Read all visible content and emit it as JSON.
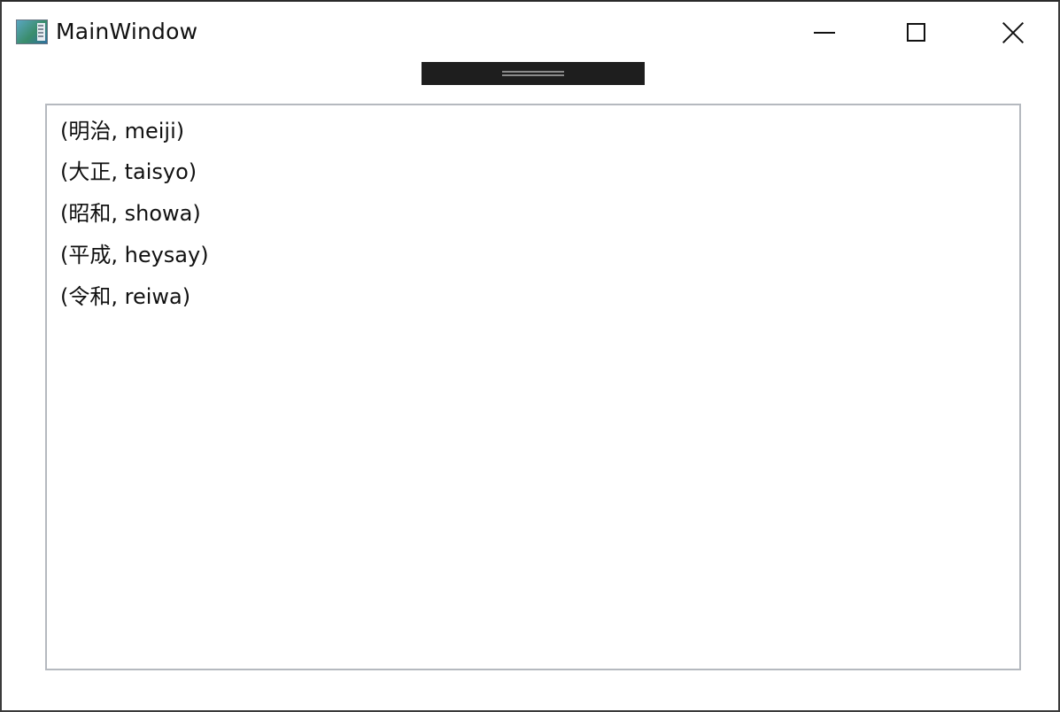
{
  "window": {
    "title": "MainWindow",
    "icon": "wpf-window-icon"
  },
  "caption_buttons": {
    "minimize": "minimize-icon",
    "maximize": "maximize-icon",
    "close": "close-icon"
  },
  "listbox": {
    "items": [
      "(明治, meiji)",
      "(大正, taisyo)",
      "(昭和, showa)",
      "(平成, heysay)",
      "(令和, reiwa)"
    ]
  },
  "colors": {
    "debug_toolbar": "#1e1e1e",
    "listbox_border": "#b5b9bf"
  }
}
